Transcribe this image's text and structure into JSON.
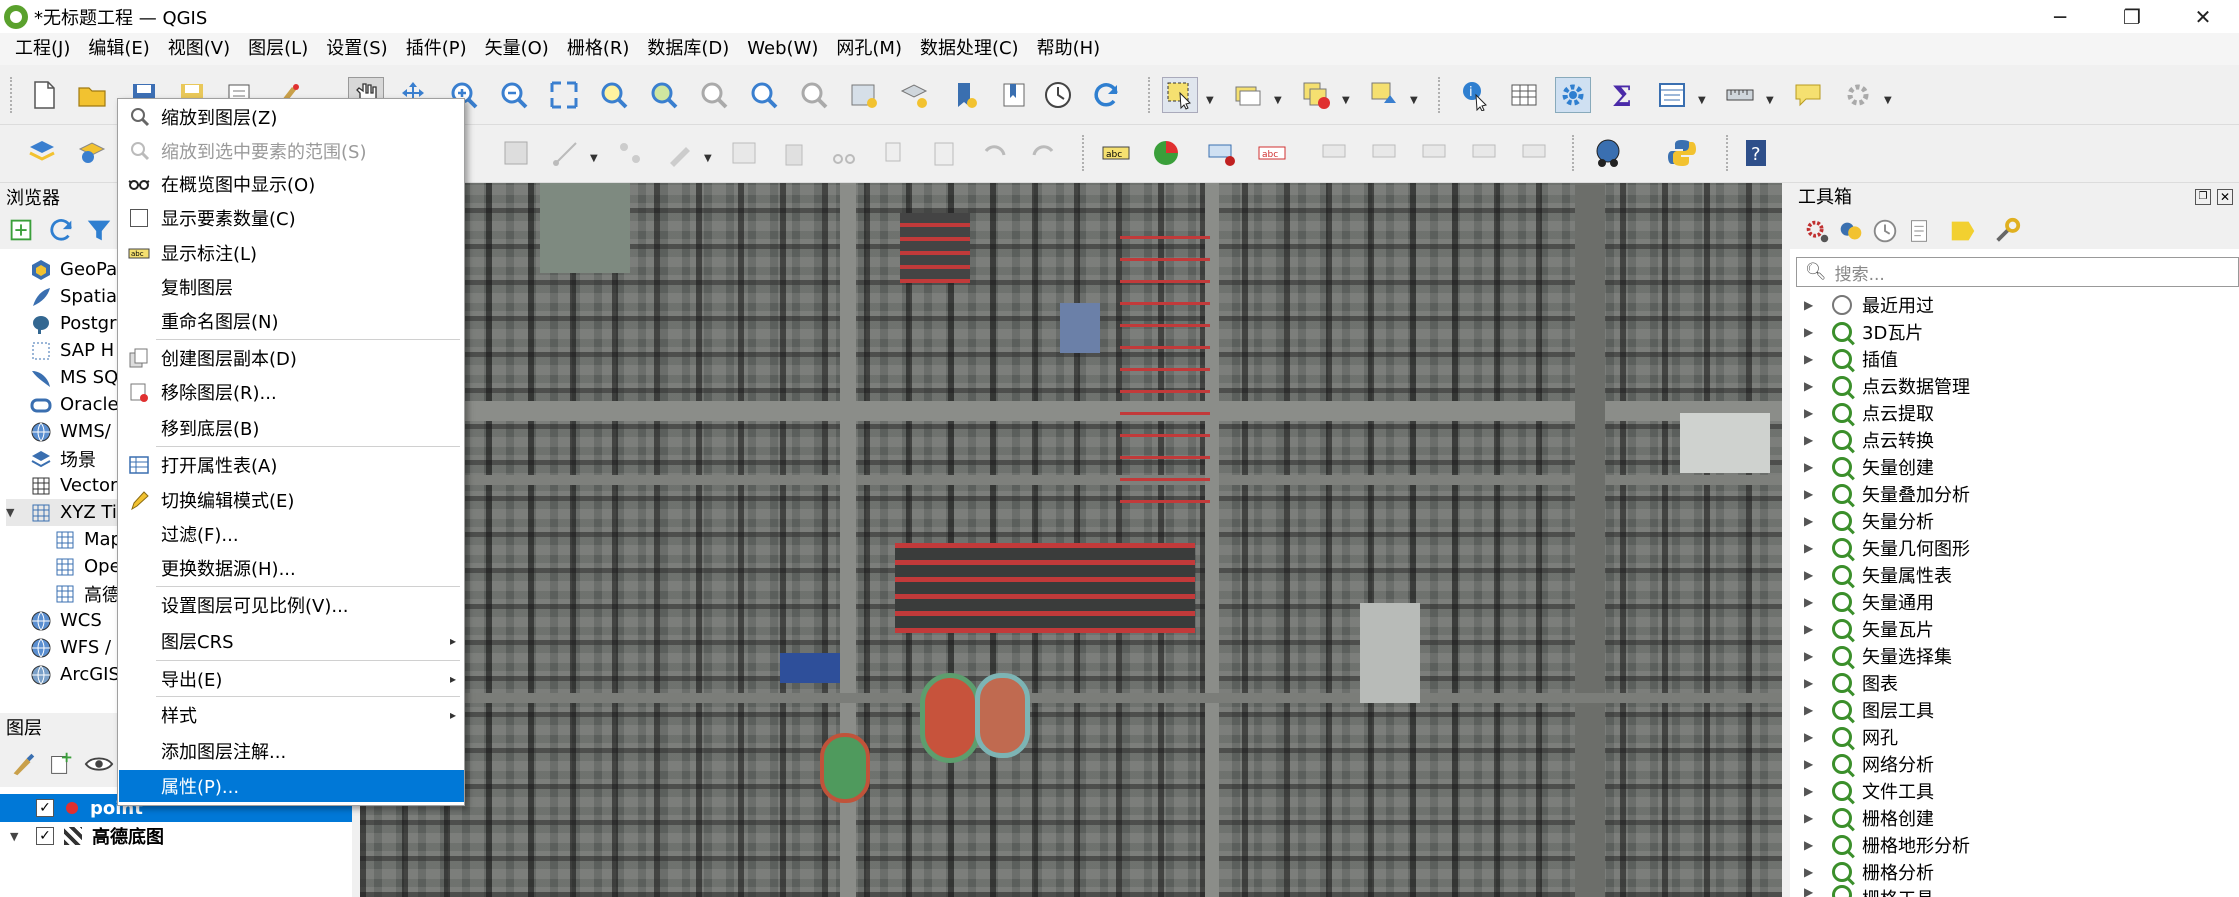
{
  "window": {
    "title": "*无标题工程 — QGIS",
    "minimize": "─",
    "maximize": "❐",
    "close": "✕"
  },
  "menubar": [
    "工程(J)",
    "编辑(E)",
    "视图(V)",
    "图层(L)",
    "设置(S)",
    "插件(P)",
    "矢量(O)",
    "栅格(R)",
    "数据库(D)",
    "Web(W)",
    "网孔(M)",
    "数据处理(C)",
    "帮助(H)"
  ],
  "browser": {
    "title": "浏览器",
    "items": [
      "GeoPa",
      "Spatia",
      "Postgr",
      "SAP H",
      "MS SQ",
      "Oracle",
      "WMS/",
      "场景",
      "Vector",
      "XYZ Ti",
      "Map",
      "Ope",
      "高德",
      "WCS",
      "WFS /",
      "ArcGIS"
    ]
  },
  "layers": {
    "title": "图层",
    "rows": [
      {
        "name": "point",
        "checked": "✓"
      },
      {
        "name": "高德底图",
        "checked": "✓"
      }
    ]
  },
  "context_menu": {
    "items": [
      "缩放到图层(Z)",
      "缩放到选中要素的范围(S)",
      "在概览图中显示(O)",
      "显示要素数量(C)",
      "显示标注(L)",
      "复制图层",
      "重命名图层(N)",
      "创建图层副本(D)",
      "移除图层(R)...",
      "移到底层(B)",
      "打开属性表(A)",
      "切换编辑模式(E)",
      "过滤(F)...",
      "更换数据源(H)...",
      "设置图层可见比例(V)...",
      "图层CRS",
      "导出(E)",
      "样式",
      "添加图层注解...",
      "属性(P)..."
    ],
    "submenu_arrow": "▸"
  },
  "toolbox": {
    "title": "工具箱",
    "search_placeholder": "搜索...",
    "items": [
      "最近用过",
      "3D瓦片",
      "插值",
      "点云数据管理",
      "点云提取",
      "点云转换",
      "矢量创建",
      "矢量叠加分析",
      "矢量分析",
      "矢量几何图形",
      "矢量属性表",
      "矢量通用",
      "矢量瓦片",
      "矢量选择集",
      "图表",
      "图层工具",
      "网孔",
      "网络分析",
      "文件工具",
      "栅格创建",
      "栅格地形分析",
      "栅格分析",
      "栅格工具"
    ],
    "expand_arrow": "▶"
  },
  "colors": {
    "selection": "#0078d7",
    "qgis_green": "#5aa12d"
  }
}
